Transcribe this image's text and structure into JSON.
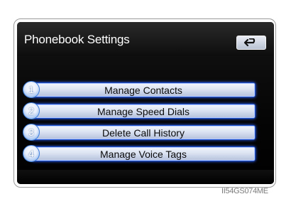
{
  "header": {
    "title": "Phonebook Settings",
    "back_icon": "back-arrow-icon"
  },
  "menu": {
    "items": [
      {
        "number": "1",
        "label": "Manage Contacts"
      },
      {
        "number": "2",
        "label": "Manage Speed Dials"
      },
      {
        "number": "3",
        "label": "Delete Call History"
      },
      {
        "number": "4",
        "label": "Manage Voice Tags"
      }
    ]
  },
  "footer": {
    "image_code": "II54GS074ME"
  },
  "colors": {
    "screen_bg": "#000000",
    "button_border": "#1f54d1",
    "number_badge": "#3f7fdc"
  }
}
